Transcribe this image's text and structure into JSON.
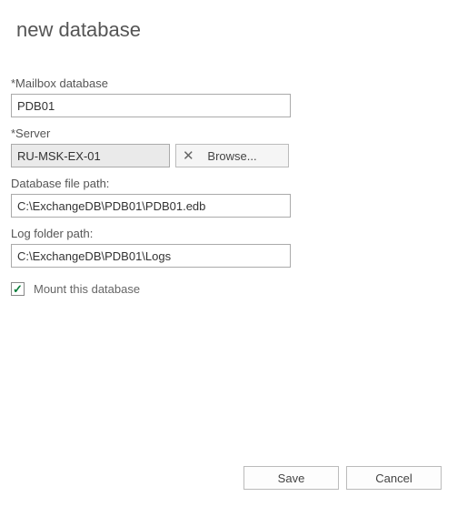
{
  "title": "new database",
  "fields": {
    "mailbox_db": {
      "label": "*Mailbox database",
      "value": "PDB01"
    },
    "server": {
      "label": "*Server",
      "value": "RU-MSK-EX-01",
      "browse_label": "Browse..."
    },
    "db_file_path": {
      "label": "Database file path:",
      "value": "C:\\ExchangeDB\\PDB01\\PDB01.edb"
    },
    "log_folder_path": {
      "label": "Log folder path:",
      "value": "C:\\ExchangeDB\\PDB01\\Logs"
    },
    "mount": {
      "label": "Mount this database",
      "checked": true
    }
  },
  "footer": {
    "save": "Save",
    "cancel": "Cancel"
  }
}
